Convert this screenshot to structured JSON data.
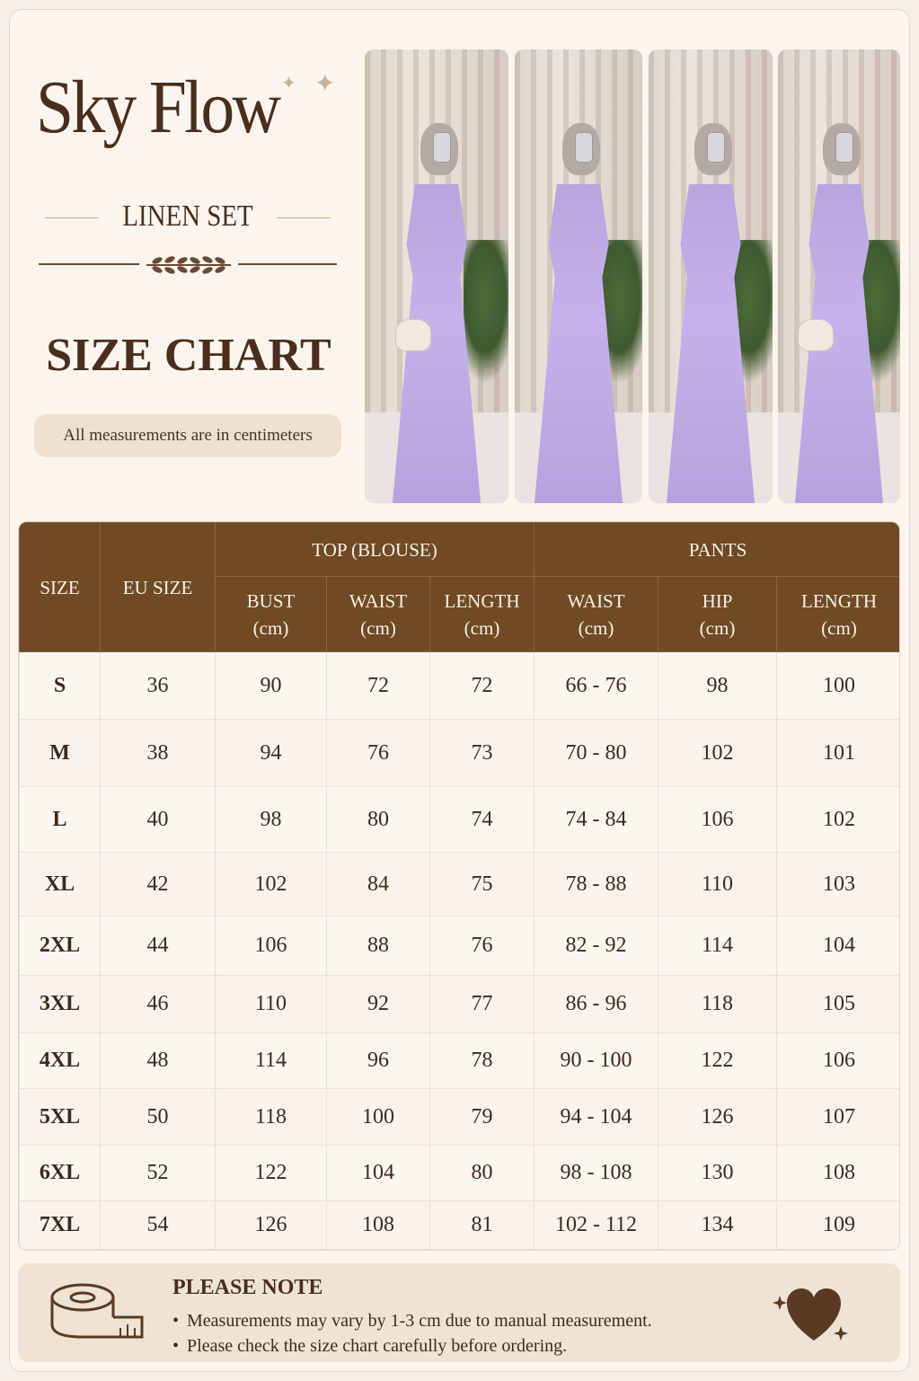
{
  "brand": {
    "title": "Sky Flow",
    "subtitle": "LINEN SET",
    "section_title": "SIZE CHART",
    "units_note": "All measurements are in centimeters"
  },
  "photos": [
    {
      "name": "model-photo-1"
    },
    {
      "name": "model-photo-2"
    },
    {
      "name": "model-photo-3"
    },
    {
      "name": "model-photo-4"
    }
  ],
  "table": {
    "headers": {
      "size": "SIZE",
      "eu_size": "EU SIZE",
      "top_group": "TOP (BLOUSE)",
      "pants_group": "PANTS",
      "top_bust": "BUST",
      "top_waist": "WAIST",
      "top_length": "LENGTH",
      "pants_waist": "WAIST",
      "pants_hip": "HIP",
      "pants_length": "LENGTH",
      "unit": "(cm)"
    },
    "rows": [
      {
        "size": "S",
        "eu": "36",
        "bust": "90",
        "twaist": "72",
        "tlength": "72",
        "pwaist": "66 - 76",
        "hip": "98",
        "plength": "100"
      },
      {
        "size": "M",
        "eu": "38",
        "bust": "94",
        "twaist": "76",
        "tlength": "73",
        "pwaist": "70 - 80",
        "hip": "102",
        "plength": "101"
      },
      {
        "size": "L",
        "eu": "40",
        "bust": "98",
        "twaist": "80",
        "tlength": "74",
        "pwaist": "74 - 84",
        "hip": "106",
        "plength": "102"
      },
      {
        "size": "XL",
        "eu": "42",
        "bust": "102",
        "twaist": "84",
        "tlength": "75",
        "pwaist": "78 - 88",
        "hip": "110",
        "plength": "103"
      },
      {
        "size": "2XL",
        "eu": "44",
        "bust": "106",
        "twaist": "88",
        "tlength": "76",
        "pwaist": "82 - 92",
        "hip": "114",
        "plength": "104"
      },
      {
        "size": "3XL",
        "eu": "46",
        "bust": "110",
        "twaist": "92",
        "tlength": "77",
        "pwaist": "86 - 96",
        "hip": "118",
        "plength": "105"
      },
      {
        "size": "4XL",
        "eu": "48",
        "bust": "114",
        "twaist": "96",
        "tlength": "78",
        "pwaist": "90 - 100",
        "hip": "122",
        "plength": "106"
      },
      {
        "size": "5XL",
        "eu": "50",
        "bust": "118",
        "twaist": "100",
        "tlength": "79",
        "pwaist": "94 - 104",
        "hip": "126",
        "plength": "107"
      },
      {
        "size": "6XL",
        "eu": "52",
        "bust": "122",
        "twaist": "104",
        "tlength": "80",
        "pwaist": "98 - 108",
        "hip": "130",
        "plength": "108"
      },
      {
        "size": "7XL",
        "eu": "54",
        "bust": "126",
        "twaist": "108",
        "tlength": "81",
        "pwaist": "102 - 112",
        "hip": "134",
        "plength": "109"
      }
    ]
  },
  "note": {
    "title": "PLEASE NOTE",
    "items": [
      "Measurements may vary by 1-3 cm due to manual measurement.",
      "Please check the size chart carefully before ordering."
    ]
  },
  "icons": {
    "sparkle": "sparkle-icon",
    "laurel": "laurel-icon",
    "tape": "measuring-tape-icon",
    "heart": "heart-icon"
  },
  "colors": {
    "header_brown": "#6f4a24",
    "background": "#fbf5ee",
    "note_bg": "#efe3d5",
    "text_dark": "#4a2e1b"
  }
}
